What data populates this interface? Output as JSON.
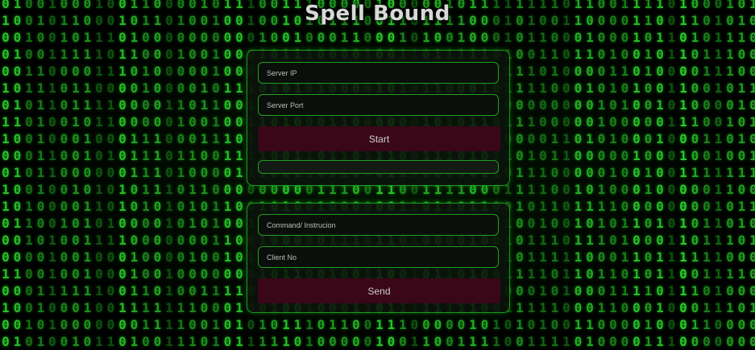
{
  "app": {
    "title": "Spell Bound"
  },
  "server_panel": {
    "server_ip": {
      "value": "",
      "placeholder": "Server IP"
    },
    "server_port": {
      "value": "",
      "placeholder": "Server Port"
    },
    "start_label": "Start",
    "progress_fraction": 0
  },
  "command_panel": {
    "command": {
      "value": "",
      "placeholder": "Command/ Instrucion"
    },
    "client_no": {
      "value": "",
      "placeholder": "Client No"
    },
    "send_label": "Send"
  },
  "colors": {
    "accent_green": "#1f9f1f",
    "button_bg": "#3a0718",
    "matrix_green": "#2bd62b"
  }
}
